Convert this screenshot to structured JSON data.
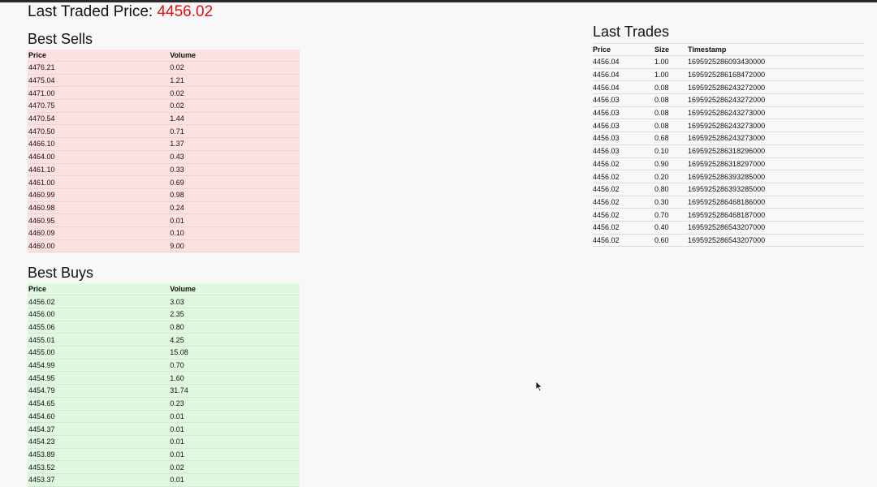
{
  "last_traded": {
    "label": "Last Traded Price: ",
    "value": "4456.02"
  },
  "best_sells": {
    "title": "Best Sells",
    "headers": [
      "Price",
      "Volume"
    ],
    "rows": [
      [
        "4476.21",
        "0.02"
      ],
      [
        "4475.04",
        "1.21"
      ],
      [
        "4471.00",
        "0.02"
      ],
      [
        "4470.75",
        "0.02"
      ],
      [
        "4470.54",
        "1.44"
      ],
      [
        "4470.50",
        "0.71"
      ],
      [
        "4466.10",
        "1.37"
      ],
      [
        "4464.00",
        "0.43"
      ],
      [
        "4461.10",
        "0.33"
      ],
      [
        "4461.00",
        "0.69"
      ],
      [
        "4460.99",
        "0.98"
      ],
      [
        "4460.98",
        "0.24"
      ],
      [
        "4460.95",
        "0.01"
      ],
      [
        "4460.09",
        "0.10"
      ],
      [
        "4460.00",
        "9.00"
      ]
    ]
  },
  "best_buys": {
    "title": "Best Buys",
    "headers": [
      "Price",
      "Volume"
    ],
    "rows": [
      [
        "4456.02",
        "3.03"
      ],
      [
        "4456.00",
        "2.35"
      ],
      [
        "4455.06",
        "0.80"
      ],
      [
        "4455.01",
        "4.25"
      ],
      [
        "4455.00",
        "15.08"
      ],
      [
        "4454.99",
        "0.70"
      ],
      [
        "4454.95",
        "1.60"
      ],
      [
        "4454.79",
        "31.74"
      ],
      [
        "4454.65",
        "0.23"
      ],
      [
        "4454.60",
        "0.01"
      ],
      [
        "4454.37",
        "0.01"
      ],
      [
        "4454.23",
        "0.01"
      ],
      [
        "4453.89",
        "0.01"
      ],
      [
        "4453.52",
        "0.02"
      ],
      [
        "4453.37",
        "0.01"
      ]
    ]
  },
  "last_trades": {
    "title": "Last Trades",
    "headers": [
      "Price",
      "Size",
      "Timestamp"
    ],
    "rows": [
      [
        "4456.04",
        "1.00",
        "1695925286093430000"
      ],
      [
        "4456.04",
        "1.00",
        "1695925286168472000"
      ],
      [
        "4456.04",
        "0.08",
        "1695925286243272000"
      ],
      [
        "4456.03",
        "0.08",
        "1695925286243272000"
      ],
      [
        "4456.03",
        "0.08",
        "1695925286243273000"
      ],
      [
        "4456.03",
        "0.08",
        "1695925286243273000"
      ],
      [
        "4456.03",
        "0.68",
        "1695925286243273000"
      ],
      [
        "4456.03",
        "0.10",
        "1695925286318296000"
      ],
      [
        "4456.02",
        "0.90",
        "1695925286318297000"
      ],
      [
        "4456.02",
        "0.20",
        "1695925286393285000"
      ],
      [
        "4456.02",
        "0.80",
        "1695925286393285000"
      ],
      [
        "4456.02",
        "0.30",
        "1695925286468186000"
      ],
      [
        "4456.02",
        "0.70",
        "1695925286468187000"
      ],
      [
        "4456.02",
        "0.40",
        "1695925286543207000"
      ],
      [
        "4456.02",
        "0.60",
        "1695925286543207000"
      ]
    ]
  },
  "colors": {
    "price_accent": "#e01010",
    "sells_bg": "#fde0e0",
    "buys_bg": "#e0f8e0"
  },
  "icons": {
    "cursor": "mouse-pointer-icon"
  }
}
